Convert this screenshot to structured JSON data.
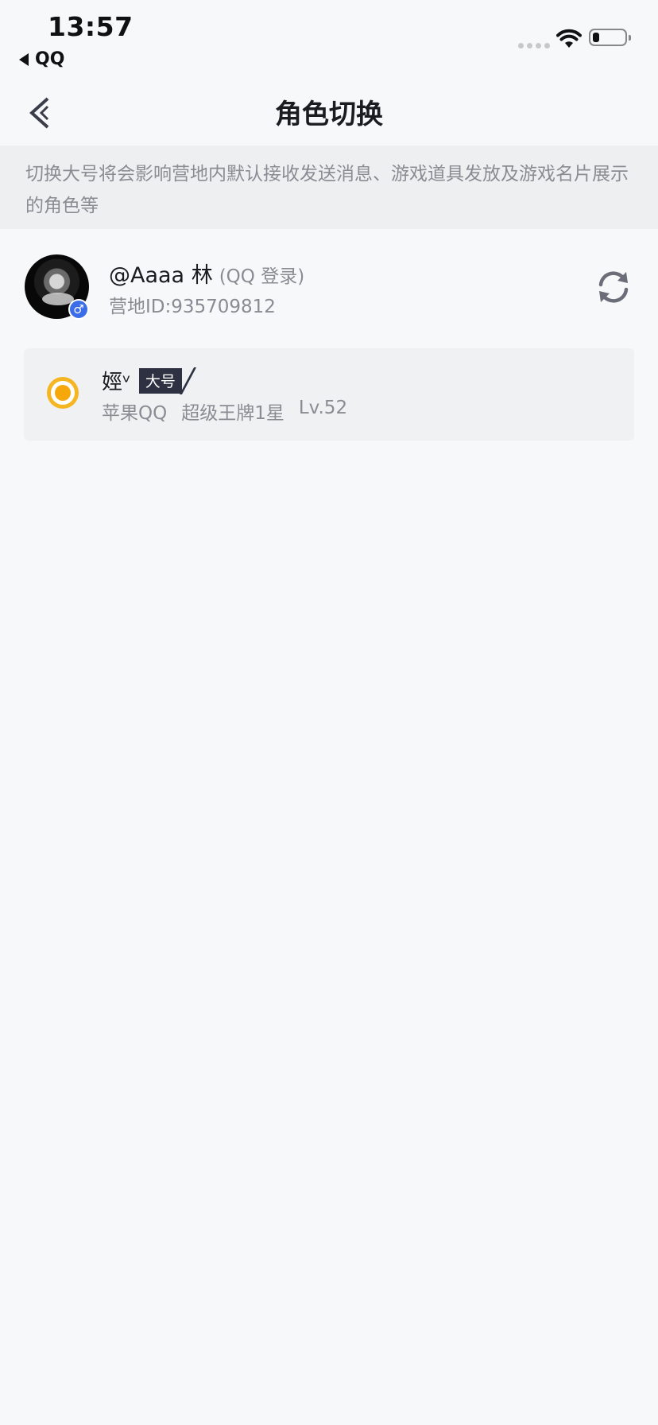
{
  "status_bar": {
    "time": "13:57",
    "back_app": "QQ"
  },
  "nav": {
    "title": "角色切换"
  },
  "notice": {
    "text": "切换大号将会影响营地内默认接收发送消息、游戏道具发放及游戏名片展示的角色等"
  },
  "account": {
    "name": "@Aaaa 林",
    "login_type": "(QQ 登录)",
    "camp_id": "营地ID:935709812",
    "gender_symbol": "♂"
  },
  "role": {
    "name": "娙ᵛ",
    "tag": "大号",
    "platform": "苹果QQ",
    "rank": "超级王牌1星",
    "level": "Lv.52",
    "selected": true
  },
  "colors": {
    "background": "#f7f8fa",
    "notice_bg": "#eeeff1",
    "accent_radio": "#f6b623",
    "tag_bg": "#2d3142",
    "gender_badge": "#3c6de8"
  },
  "icons": [
    "back-icon",
    "wifi-icon",
    "battery-icon",
    "switch-account-icon",
    "male-icon",
    "radio-selected-icon"
  ]
}
